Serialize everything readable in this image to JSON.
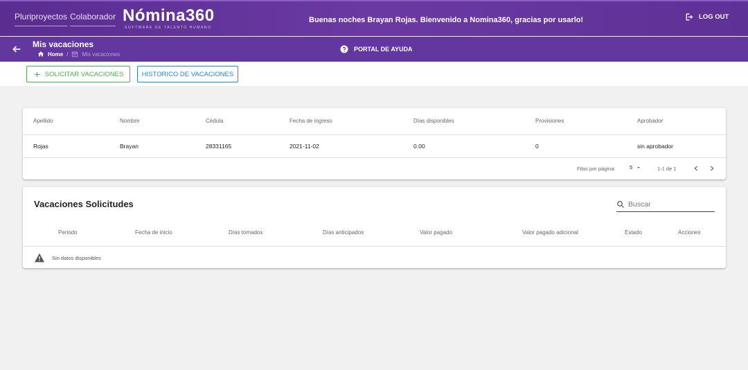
{
  "header": {
    "company": [
      "Pluriproyectos",
      "Colaborador"
    ],
    "logo_name": "Nómina360",
    "logo_tagline": "SOFTWARE DE TALENTO HUMANO",
    "greeting": "Buenas noches Brayan Rojas. Bienvenido a Nomina360, gracias por usarlo!",
    "logout_label": "LOG OUT"
  },
  "subheader": {
    "title": "Mis vacaciones",
    "breadcrumb_home": "Home",
    "breadcrumb_sep": "/",
    "breadcrumb_current": "Mis vacaciones",
    "help_label": "PORTAL DE AYUDA"
  },
  "actions": {
    "request_label": "SOLICITAR VACACIONES",
    "history_label": "HISTORICO DE VACACIONES"
  },
  "employee_table": {
    "columns": [
      "Apellido",
      "Nombre",
      "Cédula",
      "Fecha de ingreso",
      "Días disponibles",
      "Provisiones",
      "Aprobador"
    ],
    "row": [
      "Rojas",
      "Brayan",
      "28331165",
      "2021-11-02",
      "0.00",
      "0",
      "sin aprobador"
    ],
    "rows_per_page_label": "Filas por página:",
    "rows_per_page": "5",
    "range": "1-1 de 1"
  },
  "requests": {
    "title": "Vacaciones Solicitudes",
    "search_placeholder": "Buscar",
    "columns": [
      "Periodo",
      "Fecha de inicio",
      "Días tomados",
      "Días anticipados",
      "Valor pagado",
      "Valor pagado adicional",
      "Estado",
      "Acciones"
    ],
    "empty_text": "Sin datos disponibles"
  },
  "icons": {
    "back": "arrow-left-icon",
    "logout": "logout-icon",
    "help": "help-circle-icon",
    "home": "home-icon",
    "calendar": "calendar-icon",
    "plus": "plus-icon",
    "search": "search-icon",
    "warning": "warning-icon"
  },
  "colors": {
    "brand": "#5a2d91",
    "green": "#4caf50",
    "blue": "#1e88e5"
  }
}
